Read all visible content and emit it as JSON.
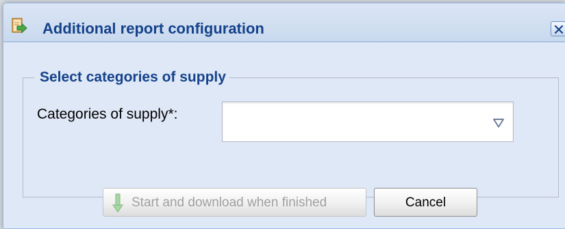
{
  "dialog": {
    "title": "Additional report configuration",
    "title_icon": "report-export-icon",
    "close_icon": "close-icon"
  },
  "fieldset": {
    "legend": "Select categories of supply",
    "field_label": "Categories of supply*:",
    "combo_value": "",
    "combo_trigger_icon": "dropdown-triangle-icon"
  },
  "buttons": {
    "start_label": "Start and download when finished",
    "start_icon": "download-arrow-icon",
    "start_disabled": true,
    "cancel_label": "Cancel"
  },
  "colors": {
    "title_text": "#15428b",
    "window_bg": "#dfe8f6",
    "border": "#99bbe8"
  }
}
